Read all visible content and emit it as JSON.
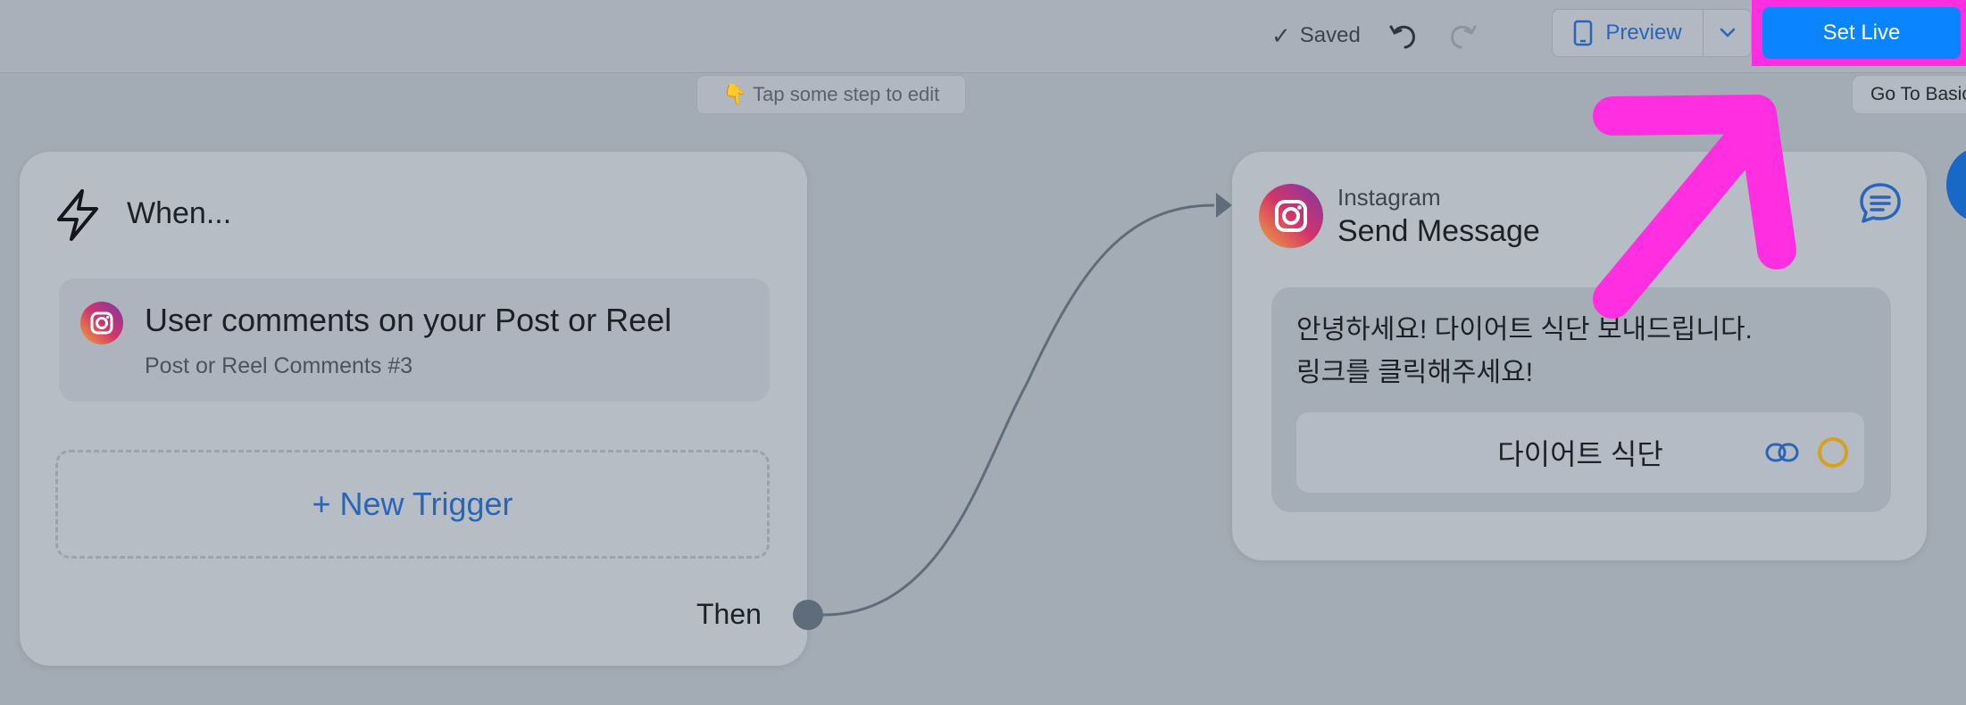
{
  "toolbar": {
    "saved_label": "Saved",
    "preview_label": "Preview",
    "set_live_label": "Set Live"
  },
  "hint": {
    "text": "Tap some step to edit"
  },
  "goto": {
    "label": "Go To Basic"
  },
  "when_card": {
    "title": "When...",
    "trigger": {
      "title": "User comments on your Post or Reel",
      "subtitle": "Post or Reel Comments #3"
    },
    "new_trigger_label": "+ New Trigger",
    "then_label": "Then"
  },
  "message_card": {
    "app": "Instagram",
    "title": "Send Message",
    "line1": "안녕하세요! 다이어트 식단 보내드립니다.",
    "line2": "링크를 클릭해주세요!",
    "button_label": "다이어트 식단"
  },
  "colors": {
    "primary": "#0a84ff",
    "highlight": "#ff2ee0",
    "link_blue": "#2a65b8"
  },
  "icons": {
    "check": "check-icon",
    "undo": "undo-icon",
    "redo": "redo-icon",
    "phone": "phone-icon",
    "chevron": "chevron-down-icon",
    "bolt": "lightning-bolt-icon",
    "instagram": "instagram-icon",
    "chat": "chat-icon",
    "link": "link-icon",
    "circle": "circle-icon",
    "hand": "pointing-down-hand-icon"
  }
}
